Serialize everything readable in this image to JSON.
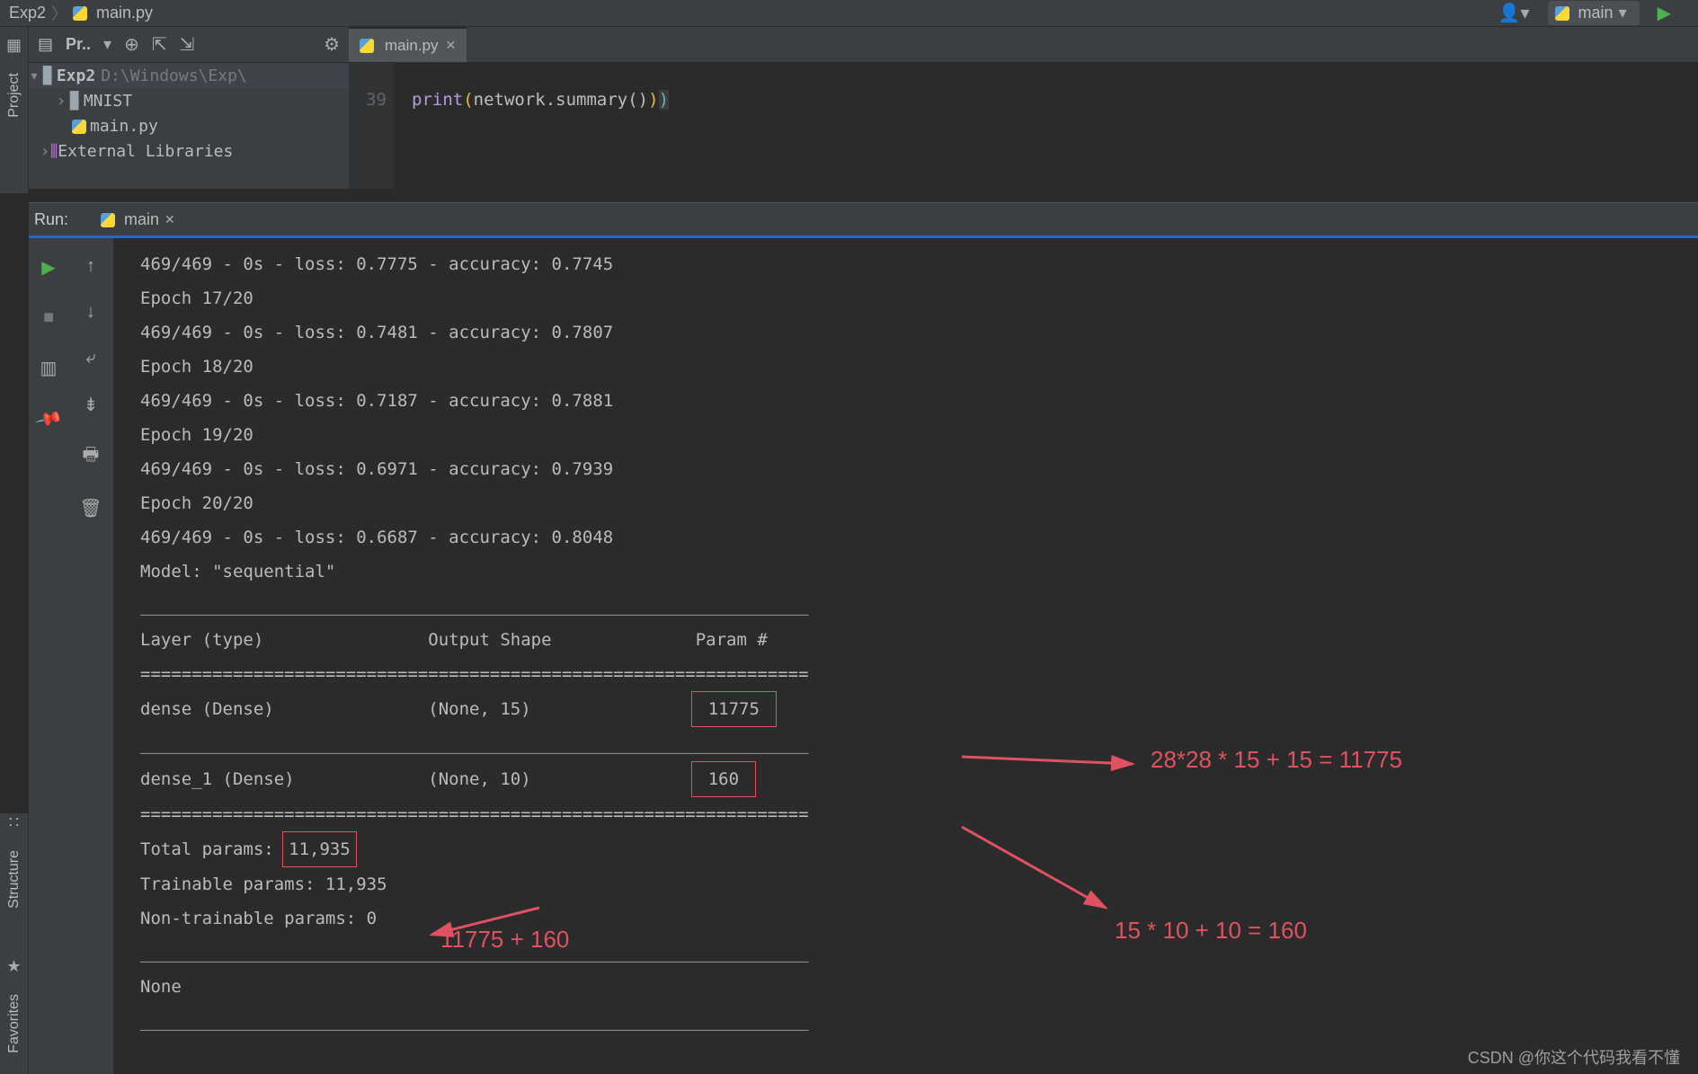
{
  "breadcrumb": {
    "project": "Exp2",
    "file": "main.py"
  },
  "git": {
    "branch": "main"
  },
  "project_tool": {
    "label": "Pr.."
  },
  "tree": {
    "root": "Exp2",
    "root_path": "D:\\Windows\\Exp\\",
    "child1": "MNIST",
    "child2": "main.py",
    "ext": "External Libraries"
  },
  "tab": {
    "name": "main.py"
  },
  "editor": {
    "line_no": "39",
    "kw": "print",
    "code_inner": "network.summary()"
  },
  "run": {
    "label": "Run:",
    "tab": "main"
  },
  "console_lines": [
    "469/469 - 0s - loss: 0.7775 - accuracy: 0.7745",
    "Epoch 17/20",
    "469/469 - 0s - loss: 0.7481 - accuracy: 0.7807",
    "Epoch 18/20",
    "469/469 - 0s - loss: 0.7187 - accuracy: 0.7881",
    "Epoch 19/20",
    "469/469 - 0s - loss: 0.6971 - accuracy: 0.7939",
    "Epoch 20/20",
    "469/469 - 0s - loss: 0.6687 - accuracy: 0.8048",
    "Model: \"sequential\""
  ],
  "summary": {
    "header": "Layer (type)                Output Shape              Param #   ",
    "row1_a": "dense (Dense)               (None, 15)                ",
    "row1_b": "11775",
    "row2_a": "dense_1 (Dense)             (None, 10)                ",
    "row2_b": "160",
    "total_a": "Total params: ",
    "total_b": "11,935",
    "trainable": "Trainable params: 11,935",
    "nontrain": "Non-trainable params: 0",
    "none": "None",
    "dash": "_________________________________________________________________",
    "eq": "================================================================="
  },
  "annotations": {
    "a1": "28*28 * 15 + 15 = 11775",
    "a2": "15 * 10 + 10 = 160",
    "a3": "11775 + 160"
  },
  "side": {
    "project": "Project",
    "structure": "Structure",
    "favorites": "Favorites"
  },
  "watermark": "CSDN @你这个代码我看不懂"
}
